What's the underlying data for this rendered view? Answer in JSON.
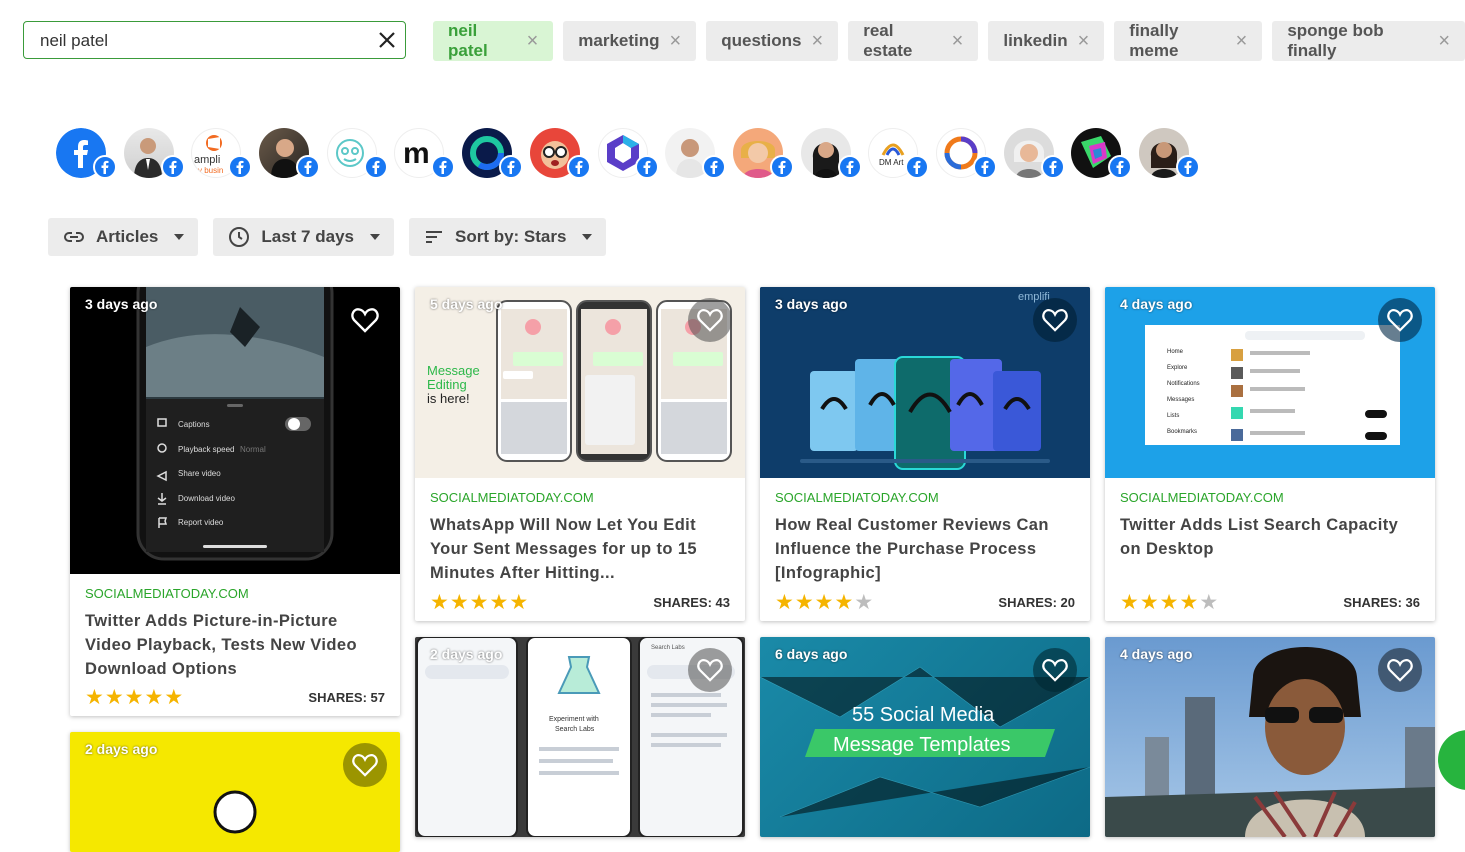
{
  "search": {
    "value": "neil patel",
    "placeholder": ""
  },
  "chips": [
    {
      "label": "neil patel",
      "active": true
    },
    {
      "label": "marketing"
    },
    {
      "label": "questions"
    },
    {
      "label": "real estate"
    },
    {
      "label": "linkedin"
    },
    {
      "label": "finally meme"
    },
    {
      "label": "sponge bob finally"
    }
  ],
  "chip_remove_glyph": "×",
  "avatar_texts": {
    "amplify": "ampli",
    "amplify_sub": "y busin",
    "m_logo": "m",
    "dm_art": "DM Art"
  },
  "filters": {
    "type_label": "Articles",
    "time_label": "Last 7 days",
    "sort_label": "Sort by: Stars"
  },
  "colors": {
    "accent": "#2aa52a",
    "star": "#f5b400",
    "facebook": "#1877f2"
  },
  "cards": [
    {
      "age": "3 days ago",
      "source": "SOCIALMEDIATODAY.COM",
      "title": "Twitter Adds Picture-in-Picture Video Playback, Tests New Video Download Options",
      "stars": 5,
      "shares": "SHARES: 57",
      "menu": [
        "Captions",
        "Playback speed",
        "Share video",
        "Download video",
        "Report video"
      ],
      "menu_extra": "Normal"
    },
    {
      "age": "5 days ago",
      "source": "SOCIALMEDIATODAY.COM",
      "title": "WhatsApp Will Now Let You Edit Your Sent Messages for up to 15 Minutes After Hitting...",
      "stars": 5,
      "shares": "SHARES: 43",
      "image_text": [
        "Message",
        "Editing",
        "is here!"
      ]
    },
    {
      "age": "3 days ago",
      "source": "SOCIALMEDIATODAY.COM",
      "title": "How Real Customer Reviews Can Influence the Purchase Process [Infographic]",
      "stars": 4,
      "shares": "SHARES: 20",
      "brand": "emplifi"
    },
    {
      "age": "4 days ago",
      "source": "SOCIALMEDIATODAY.COM",
      "title": "Twitter Adds List Search Capacity on Desktop",
      "stars": 4,
      "shares": "SHARES: 36",
      "menu": [
        "Home",
        "Explore",
        "Notifications",
        "Messages",
        "Lists",
        "Bookmarks"
      ]
    },
    {
      "age": "2 days ago",
      "image_text": [
        "Experiment with",
        "Search Labs"
      ],
      "tab_text": "Search Labs"
    },
    {
      "age": "6 days ago",
      "image_text": [
        "55 Social Media",
        "Message Templates"
      ]
    },
    {
      "age": "4 days ago"
    },
    {
      "age": "2 days ago"
    }
  ]
}
